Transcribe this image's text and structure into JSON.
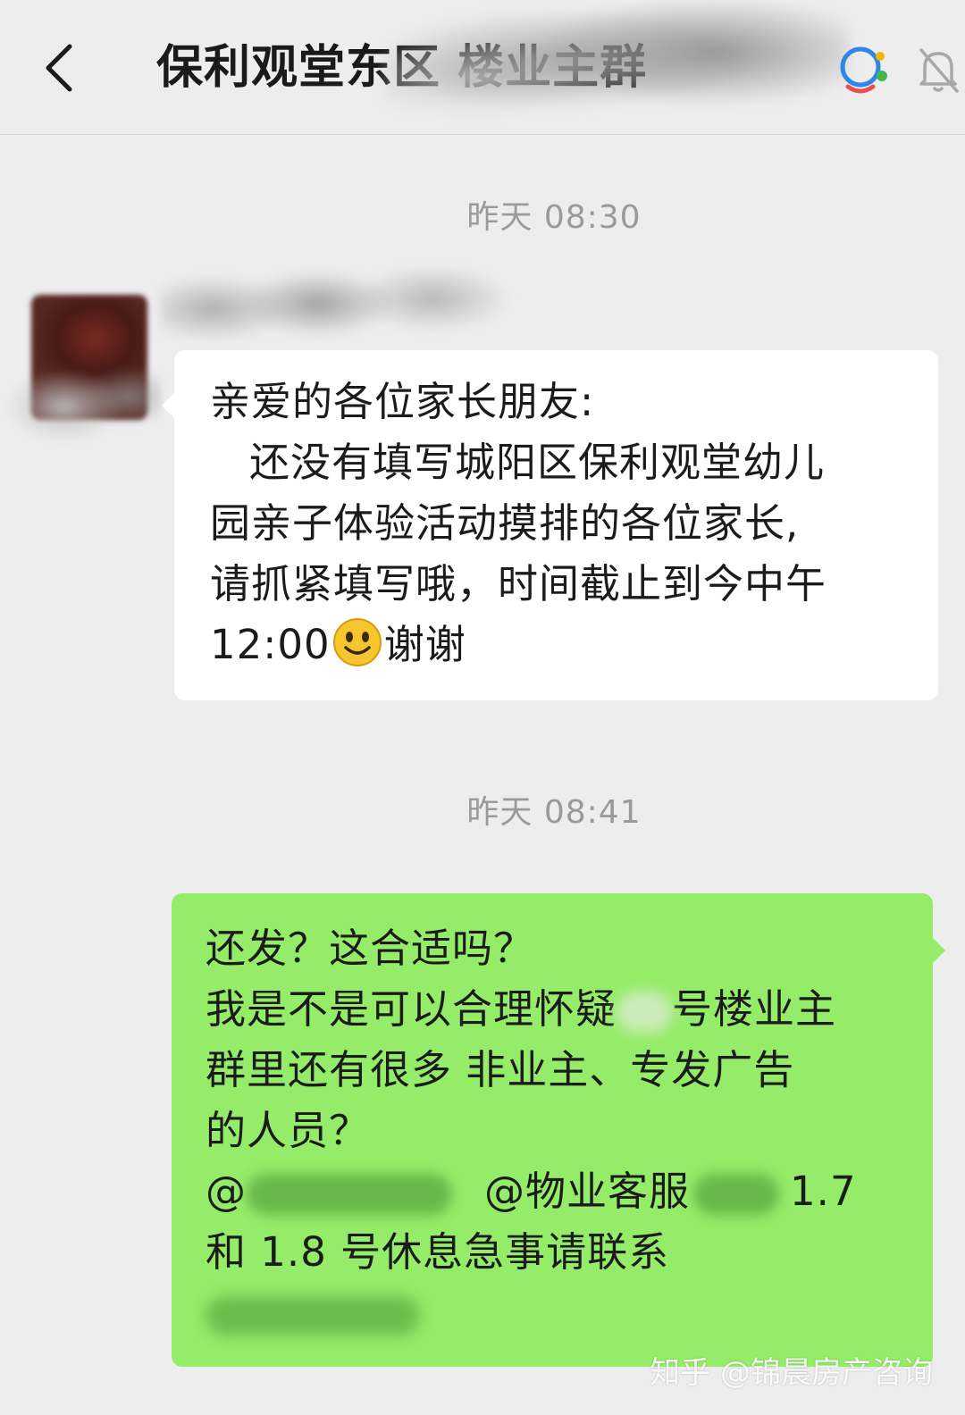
{
  "header": {
    "title": "保利观堂东区 楼业主群",
    "back_icon": "chevron-left-icon",
    "group_icon": "group-chat-icon",
    "mute_icon": "bell-off-icon"
  },
  "messages": [
    {
      "timestamp": "昨天 08:30",
      "direction": "incoming",
      "bubble_color": "#ffffff",
      "lines": [
        "亲爱的各位家长朋友:",
        "还没有填写城阳区保利观堂幼儿",
        "园亲子体验活动摸排的各位家长,",
        "请抓紧填写哦，时间截止到今中午",
        "12:00",
        "谢谢"
      ]
    },
    {
      "timestamp": "昨天 08:41",
      "direction": "outgoing",
      "bubble_color": "#95ec69",
      "lines": [
        "还发？这合适吗？",
        "我是不是可以合理怀疑",
        "号楼业主",
        "群里还有很多 非业主、专发广告",
        "的人员？",
        "@",
        "@物业客服",
        "1.7",
        "和 1.8 号休息急事请联系"
      ]
    }
  ],
  "watermark": "知乎 @锦晨房产咨询"
}
